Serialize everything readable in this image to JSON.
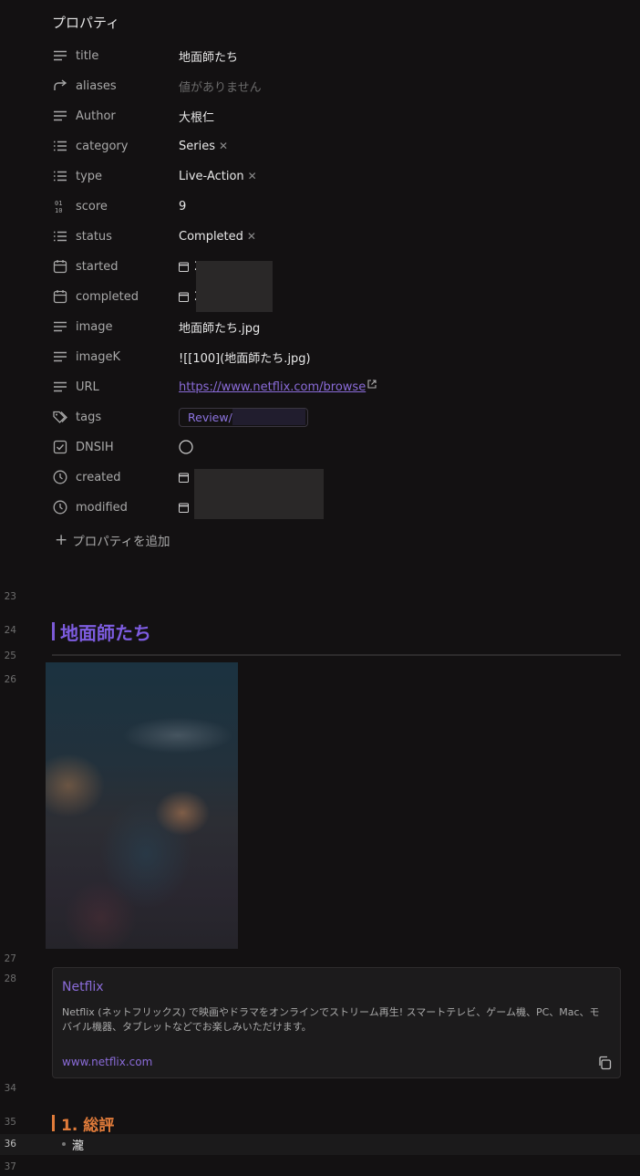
{
  "properties_heading": "プロパティ",
  "properties": [
    {
      "icon": "lines-icon",
      "name": "title",
      "value": "地面師たち"
    },
    {
      "icon": "forward-arrow-icon",
      "name": "aliases",
      "value": "値がありません",
      "empty": true
    },
    {
      "icon": "lines-icon",
      "name": "Author",
      "value": "大根仁"
    },
    {
      "icon": "list-icon",
      "name": "category",
      "value": "Series",
      "removable": true
    },
    {
      "icon": "list-icon",
      "name": "type",
      "value": "Live-Action",
      "removable": true
    },
    {
      "icon": "number-icon",
      "name": "score",
      "value": "9"
    },
    {
      "icon": "list-icon",
      "name": "status",
      "value": "Completed",
      "removable": true
    },
    {
      "icon": "calendar-icon",
      "name": "started",
      "value": "2"
    },
    {
      "icon": "calendar-icon",
      "name": "completed",
      "value": "2"
    },
    {
      "icon": "lines-icon",
      "name": "image",
      "value": "地面師たち.jpg"
    },
    {
      "icon": "lines-icon",
      "name": "imageK",
      "value": "![[100](地面師たち.jpg)"
    },
    {
      "icon": "lines-icon",
      "name": "URL",
      "value": "https://www.netflix.com/browse"
    },
    {
      "icon": "tags-icon",
      "name": "tags",
      "value": "Review/"
    },
    {
      "icon": "checkbox-icon",
      "name": "DNSIH",
      "value": ""
    },
    {
      "icon": "clock-icon",
      "name": "created",
      "value": ""
    },
    {
      "icon": "clock-icon",
      "name": "modified",
      "value": ""
    }
  ],
  "add_property": "プロパティを追加",
  "line_numbers": {
    "l23": "23",
    "l24": "24",
    "l25": "25",
    "l26": "26",
    "l27": "27",
    "l28": "28",
    "l34": "34",
    "l35": "35",
    "l36": "36",
    "l37": "37"
  },
  "heading1": "地面師たち",
  "card": {
    "title": "Netflix",
    "description": "Netflix (ネットフリックス) で映画やドラマをオンラインでストリーム再生! スマートテレビ、ゲーム機、PC、Mac、モバイル機器、タブレットなどでお楽しみいただけます。",
    "url": "www.netflix.com"
  },
  "heading2": "1. 総評",
  "list_item": "瀧",
  "colors": {
    "accent_purple": "#7d5ce0",
    "heading_orange": "#e07b3a",
    "background": "#131112"
  }
}
